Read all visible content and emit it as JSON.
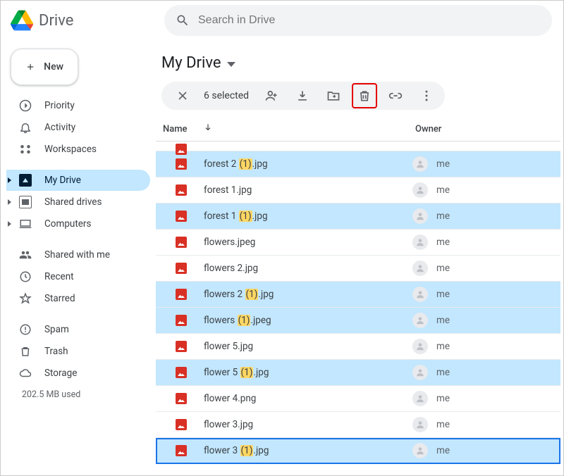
{
  "brand": {
    "name": "Drive"
  },
  "search": {
    "placeholder": "Search in Drive"
  },
  "newButton": {
    "label": "New"
  },
  "sidebar": {
    "priority": "Priority",
    "activity": "Activity",
    "workspaces": "Workspaces",
    "myDrive": "My Drive",
    "sharedDrives": "Shared drives",
    "computers": "Computers",
    "sharedWithMe": "Shared with me",
    "recent": "Recent",
    "starred": "Starred",
    "spam": "Spam",
    "trash": "Trash",
    "storage": "Storage",
    "storageUsed": "202.5 MB used"
  },
  "breadcrumb": {
    "title": "My Drive"
  },
  "selection": {
    "count": "6 selected"
  },
  "columns": {
    "name": "Name",
    "owner": "Owner"
  },
  "ownerLabel": "me",
  "files": [
    {
      "pre": "forest 2 ",
      "hl": "(1)",
      "post": ".jpg",
      "selected": true
    },
    {
      "pre": "forest 1.jpg",
      "hl": "",
      "post": "",
      "selected": false
    },
    {
      "pre": "forest 1 ",
      "hl": "(1)",
      "post": ".jpg",
      "selected": true
    },
    {
      "pre": "flowers.jpeg",
      "hl": "",
      "post": "",
      "selected": false
    },
    {
      "pre": "flowers 2.jpg",
      "hl": "",
      "post": "",
      "selected": false
    },
    {
      "pre": "flowers 2 ",
      "hl": "(1)",
      "post": ".jpg",
      "selected": true
    },
    {
      "pre": "flowers ",
      "hl": "(1)",
      "post": ".jpeg",
      "selected": true
    },
    {
      "pre": "flower 5.jpg",
      "hl": "",
      "post": "",
      "selected": false
    },
    {
      "pre": "flower 5 ",
      "hl": "(1)",
      "post": ".jpg",
      "selected": true
    },
    {
      "pre": "flower 4.png",
      "hl": "",
      "post": "",
      "selected": false
    },
    {
      "pre": "flower 3.jpg",
      "hl": "",
      "post": "",
      "selected": false
    },
    {
      "pre": "flower 3 ",
      "hl": "(1)",
      "post": ".jpg",
      "selected": true,
      "active": true
    }
  ]
}
